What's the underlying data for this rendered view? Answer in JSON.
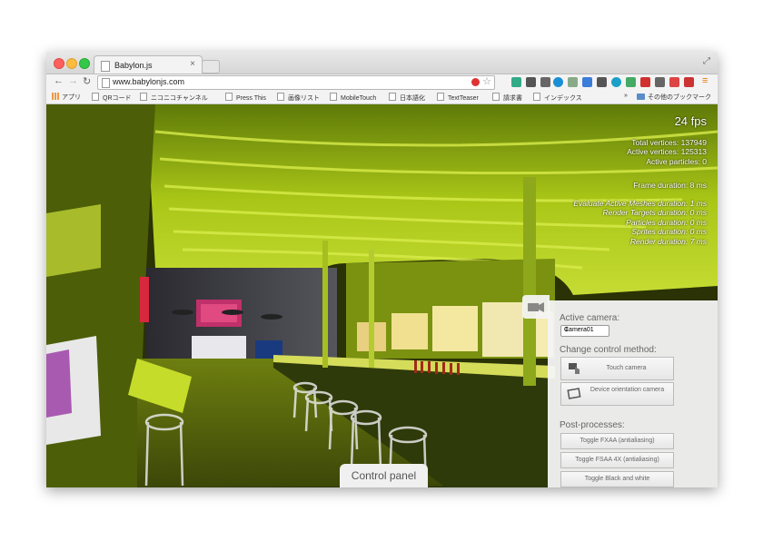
{
  "browser": {
    "tab_title": "Babylon.js",
    "tab_close": "×",
    "url": "www.babylonjs.com",
    "bookmarks": [
      "アプリ",
      "QRコード",
      "ニコニコチャンネル",
      "Press This",
      "画像リスト",
      "MobileTouch",
      "日本語化",
      "TextTeaser",
      "請求書",
      "インデックス"
    ],
    "bookmarks_more": "»",
    "other_bookmarks": "その他のブックマーク"
  },
  "stats": {
    "fps": "24 fps",
    "total_vertices": "Total vertices: 137949",
    "active_vertices": "Active vertices: 125313",
    "active_particles": "Active particles: 0",
    "frame_duration": "Frame duration: 8 ms",
    "evaluate_duration": "Evaluate Active Meshes duration: 1 ms",
    "render_targets_duration": "Render Targets duration: 0 ms",
    "particles_duration": "Particles duration: 0 ms",
    "sprites_duration": "Sprites duration: 0 ms",
    "render_duration": "Render duration: 7 ms"
  },
  "control_panel": {
    "active_camera_label": "Active camera:",
    "camera_value": "Camera01",
    "change_control_label": "Change control method:",
    "touch_camera": "Touch camera",
    "device_orientation_camera": "Device orientation camera",
    "post_processes_label": "Post-processes:",
    "toggle_fxaa": "Toggle FXAA (antialiasing)",
    "toggle_fsaa": "Toggle FSAA 4X (antialiasing)",
    "toggle_bw": "Toggle Black and white",
    "tab_label": "Control panel"
  },
  "colors": {
    "scene_green": "#a9c617",
    "panel_bg": "#f4f4f4"
  }
}
